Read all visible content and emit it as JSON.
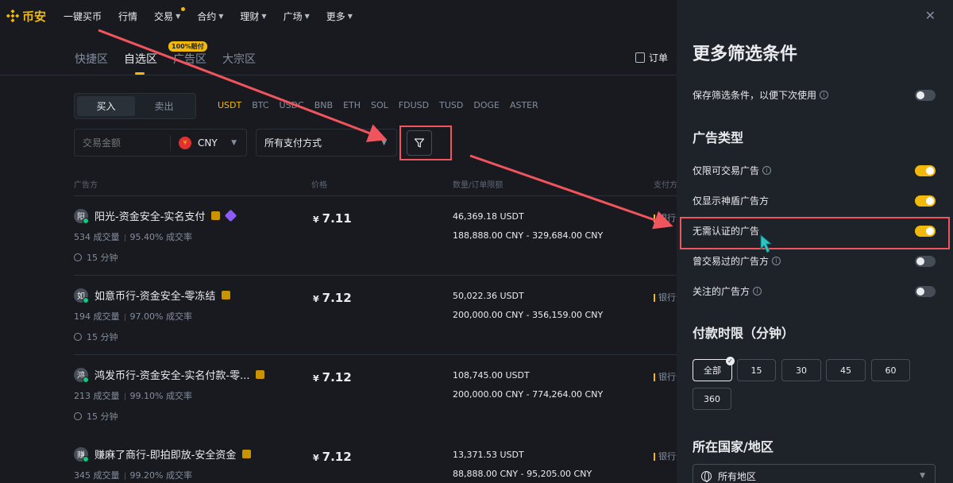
{
  "nav": {
    "logo": "币安",
    "items": [
      {
        "label": "一键买币",
        "chev": false,
        "dot": false
      },
      {
        "label": "行情",
        "chev": false,
        "dot": false
      },
      {
        "label": "交易",
        "chev": true,
        "dot": true
      },
      {
        "label": "合约",
        "chev": true,
        "dot": false
      },
      {
        "label": "理财",
        "chev": true,
        "dot": false
      },
      {
        "label": "广场",
        "chev": true,
        "dot": false
      },
      {
        "label": "更多",
        "chev": true,
        "dot": false
      }
    ]
  },
  "tabs": {
    "items": [
      "快捷区",
      "自选区",
      "广告区",
      "大宗区"
    ],
    "active": 1,
    "badge": "100%赔付",
    "orders": "订单"
  },
  "trade": {
    "buy": "买入",
    "sell": "卖出",
    "coins": [
      "USDT",
      "BTC",
      "USDC",
      "BNB",
      "ETH",
      "SOL",
      "FDUSD",
      "TUSD",
      "DOGE",
      "ASTER"
    ],
    "amount_placeholder": "交易金额",
    "currency": "CNY",
    "currency_icon": "¥",
    "payment": "所有支付方式"
  },
  "table": {
    "headers": {
      "advertiser": "广告方",
      "price": "价格",
      "quantity": "数量/订单限额",
      "payment": "支付方式"
    },
    "rows": [
      {
        "avatar": "阳",
        "name": "阳光-资金安全-实名支付",
        "diamond": true,
        "trades": "534 成交量",
        "rate": "95.40% 成交率",
        "time": "15 分钟",
        "price": "7.11",
        "amount": "46,369.18 USDT",
        "limit": "188,888.00 CNY - 329,684.00 CNY",
        "bank": "银行卡"
      },
      {
        "avatar": "如",
        "name": "如意币行-资金安全-零冻结",
        "diamond": false,
        "trades": "194 成交量",
        "rate": "97.00% 成交率",
        "time": "15 分钟",
        "price": "7.12",
        "amount": "50,022.36 USDT",
        "limit": "200,000.00 CNY - 356,159.00 CNY",
        "bank": "银行卡"
      },
      {
        "avatar": "鸿",
        "name": "鸿发币行-资金安全-实名付款-零...",
        "diamond": false,
        "trades": "213 成交量",
        "rate": "99.10% 成交率",
        "time": "15 分钟",
        "price": "7.12",
        "amount": "108,745.00 USDT",
        "limit": "200,000.00 CNY - 774,264.00 CNY",
        "bank": "银行卡"
      },
      {
        "avatar": "赚",
        "name": "赚麻了商行-即拍即放-安全资金",
        "diamond": false,
        "trades": "345 成交量",
        "rate": "99.20% 成交率",
        "time": "15 分钟",
        "price": "7.12",
        "amount": "13,371.53 USDT",
        "limit": "88,888.00 CNY - 95,205.00 CNY",
        "bank": "银行卡"
      }
    ],
    "currency_symbol": "¥"
  },
  "panel": {
    "title": "更多筛选条件",
    "save": {
      "label": "保存筛选条件，以便下次使用",
      "on": false
    },
    "ad_type_title": "广告类型",
    "ad_types": [
      {
        "label": "仅限可交易广告",
        "info": true,
        "on": true
      },
      {
        "label": "仅显示神盾广告方",
        "info": false,
        "on": true
      },
      {
        "label": "无需认证的广告",
        "info": false,
        "on": true
      },
      {
        "label": "曾交易过的广告方",
        "info": true,
        "on": false
      },
      {
        "label": "关注的广告方",
        "info": true,
        "on": false
      }
    ],
    "time_title": "付款时限（分钟）",
    "time_options": [
      "全部",
      "15",
      "30",
      "45",
      "60",
      "360"
    ],
    "time_selected": 0,
    "region_title": "所在国家/地区",
    "region_value": "所有地区"
  }
}
